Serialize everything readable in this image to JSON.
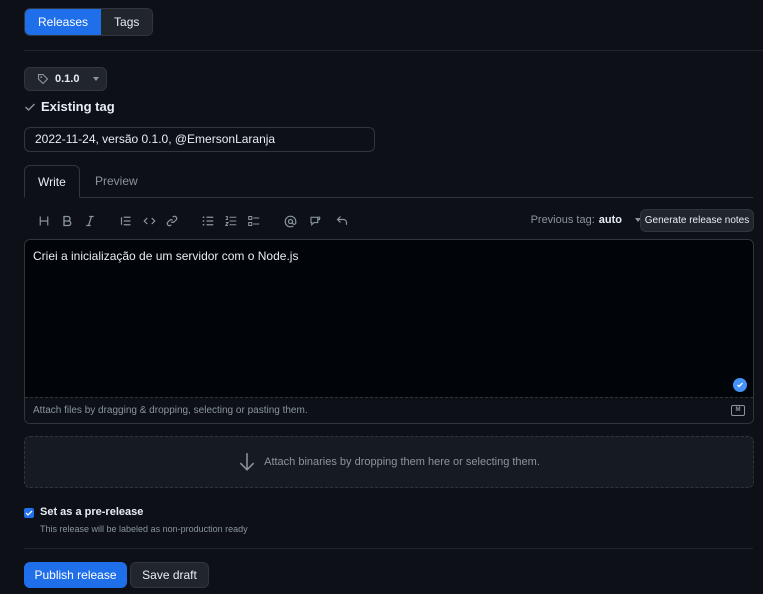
{
  "nav": {
    "releases": "Releases",
    "tags": "Tags"
  },
  "tag": {
    "value": "0.1.0",
    "status": "Existing tag"
  },
  "release_title": {
    "value": "2022-11-24, versão 0.1.0, @EmersonLaranja"
  },
  "editor_tabs": {
    "write": "Write",
    "preview": "Preview"
  },
  "toolbar": {
    "icons": [
      "heading-icon",
      "bold-icon",
      "italic-icon",
      "quote-icon",
      "code-icon",
      "link-icon",
      "bulleted-list-icon",
      "numbered-list-icon",
      "task-list-icon",
      "mention-icon",
      "reference-icon",
      "undo-icon"
    ],
    "previous_tag_label": "Previous tag:",
    "previous_tag_value": "auto",
    "generate_notes": "Generate release notes"
  },
  "editor": {
    "body": "Criei a inicialização de um servidor com o Node.js",
    "attach_hint": "Attach files by dragging & dropping, selecting or pasting them."
  },
  "binaries": {
    "hint": "Attach binaries by dropping them here or selecting them."
  },
  "prerelease": {
    "checked": true,
    "label": "Set as a pre-release",
    "hint": "This release will be labeled as non-production ready"
  },
  "actions": {
    "publish": "Publish release",
    "save_draft": "Save draft"
  },
  "colors": {
    "accent": "#1f6feb",
    "background": "#0d1117",
    "editor_bg": "#010409",
    "border": "#30363d"
  }
}
